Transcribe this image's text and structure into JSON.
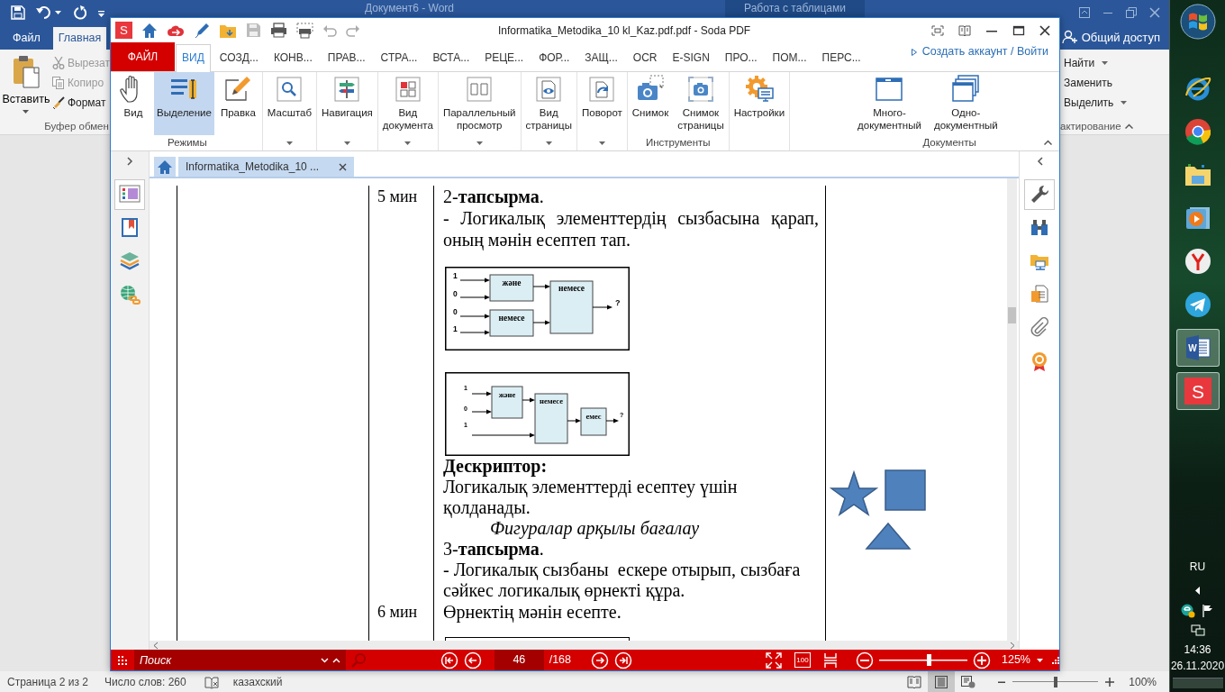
{
  "word": {
    "title": "Документ6 - Word",
    "context_tab": "Работа с таблицами",
    "tabs": [
      {
        "label": "Файл",
        "selected": false
      },
      {
        "label": "Главная",
        "selected": true
      }
    ],
    "share": "Общий доступ",
    "clipboard": {
      "paste": "Вставить",
      "commands": [
        {
          "label": "Вырезат",
          "disabled": true
        },
        {
          "label": "Копиро",
          "disabled": true
        },
        {
          "label": "Формат",
          "disabled": false
        }
      ],
      "group": "Буфер обмен"
    },
    "editing": {
      "commands": [
        {
          "label": "Найти",
          "dropdown": true
        },
        {
          "label": "Заменить",
          "dropdown": false
        },
        {
          "label": "Выделить",
          "dropdown": true
        }
      ],
      "group": "актирование"
    },
    "status_bar": {
      "page": "Страница 2 из 2",
      "words": "Число слов: 260",
      "language": "казахский",
      "views": [
        {
          "selected": false
        },
        {
          "selected": true
        },
        {
          "selected": false
        }
      ],
      "zoom": {
        "level": 0.5
      },
      "zoom_text": "100%"
    }
  },
  "soda": {
    "logo": "S",
    "title": "Informatika_Metodika_10 kl_Kaz.pdf.pdf - Soda PDF",
    "tabs": [
      {
        "label": "ФАЙЛ",
        "kind": "file",
        "selected": false
      },
      {
        "label": "ВИД",
        "kind": "tab",
        "selected": true
      },
      {
        "label": "СОЗД...",
        "kind": "tab",
        "selected": false
      },
      {
        "label": "КОНВ...",
        "kind": "tab",
        "selected": false
      },
      {
        "label": "ПРАВ...",
        "kind": "tab",
        "selected": false
      },
      {
        "label": "СТРА...",
        "kind": "tab",
        "selected": false
      },
      {
        "label": "ВСТА...",
        "kind": "tab",
        "selected": false
      },
      {
        "label": "РЕЦЕ...",
        "kind": "tab",
        "selected": false
      },
      {
        "label": "ФОР...",
        "kind": "tab",
        "selected": false
      },
      {
        "label": "ЗАЩ...",
        "kind": "tab",
        "selected": false
      },
      {
        "label": "OCR",
        "kind": "tab",
        "selected": false
      },
      {
        "label": "E-SIGN",
        "kind": "tab",
        "selected": false
      },
      {
        "label": "ПРО...",
        "kind": "tab",
        "selected": false
      },
      {
        "label": "ПОМ...",
        "kind": "tab",
        "selected": false
      },
      {
        "label": "ПЕРС...",
        "kind": "tab",
        "selected": false
      }
    ],
    "account": "Создать аккаунт / Войти",
    "ribbon": [
      {
        "label": "Режимы",
        "buttons": [
          {
            "label": "Вид",
            "selected": false
          },
          {
            "label": "Выделение",
            "selected": true
          },
          {
            "label": "Правка",
            "selected": false
          }
        ]
      },
      {
        "dropdown": true,
        "buttons": [
          {
            "label": "Масштаб"
          }
        ]
      },
      {
        "dropdown": true,
        "buttons": [
          {
            "label": "Навигация"
          }
        ]
      },
      {
        "dropdown": true,
        "buttons": [
          {
            "label": "Вид\nдокумента"
          }
        ]
      },
      {
        "dropdown": true,
        "buttons": [
          {
            "label": "Параллельный\nпросмотр"
          }
        ]
      },
      {
        "dropdown": true,
        "buttons": [
          {
            "label": "Вид\nстраницы"
          }
        ]
      },
      {
        "dropdown": true,
        "buttons": [
          {
            "label": "Поворот"
          }
        ]
      },
      {
        "label": "Инструменты",
        "buttons": [
          {
            "label": "Снимок"
          },
          {
            "label": "Снимок\nстраницы"
          }
        ]
      },
      {
        "buttons": [
          {
            "label": "Настройки"
          }
        ]
      },
      {
        "label": "Документы",
        "buttons": [
          {
            "label": "Много-\nдокументный"
          },
          {
            "label": "Одно-\nдокументный"
          }
        ]
      }
    ],
    "left_panel": [
      {
        "selected": true
      },
      {
        "selected": false
      },
      {
        "selected": false
      },
      {
        "selected": false
      }
    ],
    "doc_tab": "Informatika_Metodika_10 ...",
    "right_panel": [
      {
        "selected": true
      },
      {
        "selected": false
      },
      {
        "selected": false
      },
      {
        "selected": false
      },
      {
        "selected": false
      },
      {
        "selected": false
      }
    ],
    "document": {
      "rows": [
        {
          "kind": "task",
          "time": "5 мин",
          "blocks": [
            {
              "kind": "heading",
              "text": "2-**тапсырма**."
            },
            {
              "kind": "paragraph",
              "text": "- Логикалық элементтердің сызбасына қарап, оның мәнін есептеп тап."
            },
            {
              "kind": "gate_tree",
              "inputs": [
                "1",
                "0",
                "0",
                "1"
              ],
              "gates": [
                "және",
                "немесе",
                "немесе"
              ],
              "output": "?"
            },
            {
              "kind": "gate_chain",
              "inputs": [
                "1",
                "0",
                "1"
              ],
              "gates": [
                "және",
                "немесе",
                "емес"
              ],
              "output": "?"
            }
          ]
        },
        {
          "kind": "assessment",
          "blocks": [
            {
              "kind": "title",
              "text": "Дескриптор:"
            },
            {
              "kind": "text",
              "text": "Логикалық элементтерді есептеу үшін\nқолданады."
            },
            {
              "kind": "note",
              "text": "Фигуралар арқылы бағалау"
            },
            {
              "kind": "heading",
              "text": "3-**тапсырма**."
            },
            {
              "kind": "text",
              "text": "- Логикалық сызбаны  ескере отырып, сызбаға сәйкес логикалық өрнекті құра."
            }
          ]
        },
        {
          "kind": "task",
          "time": "6 мин",
          "blocks": [
            {
              "kind": "text",
              "text": "Өрнектің мәнін есепте."
            },
            {
              "kind": "frame"
            }
          ]
        }
      ]
    },
    "bottom_bar": {
      "search": {
        "placeholder": "Поиск"
      },
      "page": "46",
      "total": "/168",
      "actual_size": "100",
      "zoom": {
        "level": 0.56
      },
      "zoom_text": "125%"
    }
  },
  "taskbar": {
    "apps": [
      {
        "active": false
      },
      {
        "active": false
      },
      {
        "active": false
      },
      {
        "active": false
      },
      {
        "active": false
      },
      {
        "active": false
      },
      {
        "active": true,
        "label": "W"
      },
      {
        "active": true,
        "label": "S"
      }
    ],
    "language": "RU",
    "time": "14:36",
    "date": "26.11.2020"
  }
}
